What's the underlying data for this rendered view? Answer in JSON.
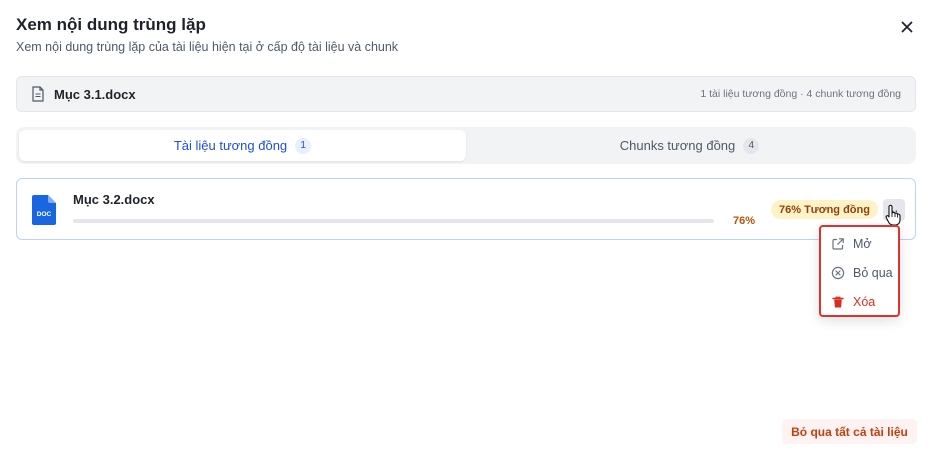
{
  "dialog": {
    "title": "Xem nội dung trùng lặp",
    "subtitle": "Xem nội dung trùng lặp của tài liệu hiện tại ở cấp độ tài liệu và chunk"
  },
  "current_file": {
    "name": "Mục 3.1.docx",
    "summary": "1 tài liệu tương đồng · 4 chunk tương đồng"
  },
  "tabs": [
    {
      "label": "Tài liệu tương đồng",
      "count": "1",
      "active": true
    },
    {
      "label": "Chunks tương đồng",
      "count": "4",
      "active": false
    }
  ],
  "similar_documents": [
    {
      "name": "Mục 3.2.docx",
      "icon_text": "DOC",
      "similarity_percent": "76%",
      "similarity_fraction": 0.76,
      "similarity_badge": "76% Tương đồng"
    }
  ],
  "context_menu": {
    "items": [
      {
        "label": "Mở",
        "icon": "external-link-icon"
      },
      {
        "label": "Bỏ qua",
        "icon": "circle-x-icon"
      },
      {
        "label": "Xóa",
        "icon": "trash-icon",
        "danger": true
      }
    ]
  },
  "footer": {
    "skip_all_label": "Bỏ qua tất cả tài liệu"
  },
  "colors": {
    "accent": "#1d4ed8",
    "danger": "#d92d20",
    "badge_bg": "#fef3c7",
    "menu_highlight_border": "#e03131"
  }
}
